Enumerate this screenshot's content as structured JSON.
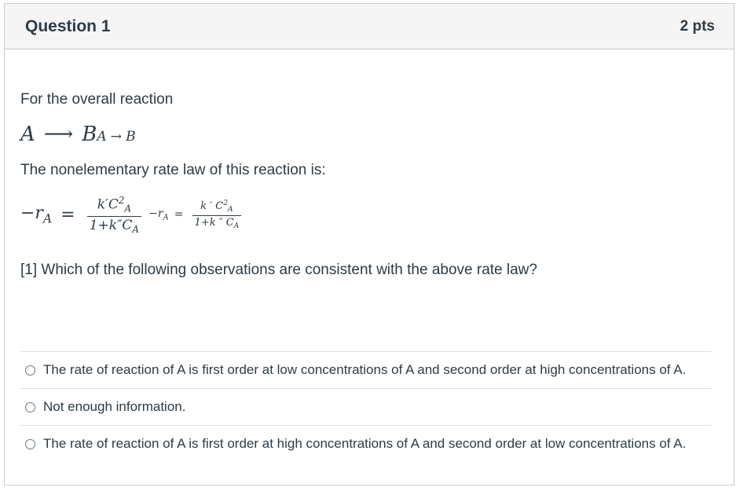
{
  "question": {
    "title": "Question 1",
    "points": "2 pts"
  },
  "body": {
    "intro": "For the overall reaction",
    "reaction": {
      "lhs": "A",
      "arrow": "⟶",
      "rhs": "B",
      "alt_lhs": "A",
      "alt_arrow": "→",
      "alt_rhs": "B"
    },
    "rate_law_intro": "The nonelementary rate law of this reaction is:",
    "rate_law": {
      "lhs": "−r",
      "lhs_sub": "A",
      "equals": "=",
      "num_k": "k′C",
      "num_sub": "A",
      "num_sup": "2",
      "den_prefix": "1+k″C",
      "den_sub": "A",
      "alt_lhs": "−r",
      "alt_lhs_sub": "A",
      "alt_equals": "=",
      "alt_num": "k ′ C",
      "alt_num_sub": "A",
      "alt_num_sup": "2",
      "alt_den": "1+k ″ C",
      "alt_den_sub": "A"
    },
    "prompt": "[1] Which of the following observations are consistent with the above rate law?"
  },
  "answers": [
    {
      "label": "The rate of reaction of A is first order at low concentrations of A and second order at high concentrations of A."
    },
    {
      "label": "Not enough information."
    },
    {
      "label": "The rate of reaction of A is first order at high concentrations of A and second order at low concentrations of A."
    }
  ]
}
